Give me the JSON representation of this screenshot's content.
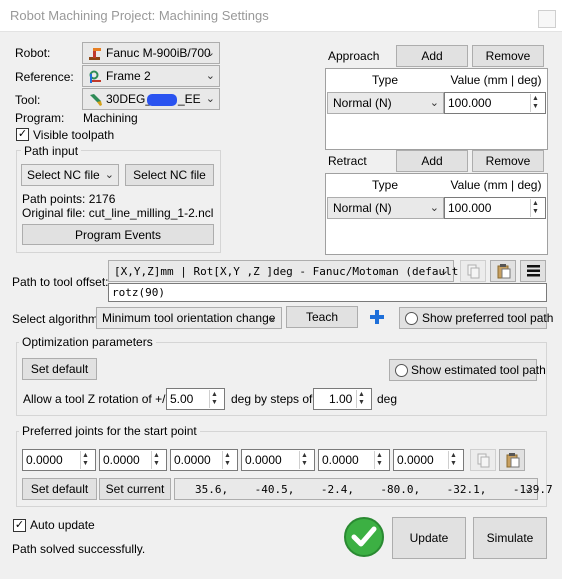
{
  "window": {
    "title": "Robot Machining Project: Machining Settings"
  },
  "robot": {
    "label": "Robot:",
    "value": "Fanuc M-900iB/700"
  },
  "reference": {
    "label": "Reference:",
    "value": "Frame 2"
  },
  "tool": {
    "label": "Tool:",
    "value_a": "30DEG_",
    "value_b": "_EE"
  },
  "program": {
    "label": "Program:",
    "value": "Machining"
  },
  "visible_toolpath": {
    "label": "Visible toolpath",
    "checked": true
  },
  "path_input": {
    "group_label": "Path input",
    "select_combo": "Select NC file",
    "select_button": "Select NC file",
    "path_points": "Path points: 2176",
    "original_file": "Original file: cut_line_milling_1-2.ncl",
    "events_button": "Program Events"
  },
  "approach": {
    "label": "Approach",
    "add": "Add",
    "remove": "Remove",
    "col_type": "Type",
    "col_value": "Value (mm | deg)",
    "row_type": "Normal (N)",
    "row_value": "100.000"
  },
  "retract": {
    "label": "Retract",
    "add": "Add",
    "remove": "Remove",
    "col_type": "Type",
    "col_value": "Value (mm | deg)",
    "row_type": "Normal (N)",
    "row_value": "100.000"
  },
  "tool_offset": {
    "label": "Path to tool offset:",
    "format": "[X,Y,Z]mm | Rot[X,Y ,Z  ]deg - Fanuc/Motoman (default)",
    "expression": "rotz(90)"
  },
  "algorithm": {
    "label": "Select algorithm:",
    "value": "Minimum tool orientation change",
    "teach": "Teach",
    "show_preferred": "Show preferred tool path"
  },
  "optimization": {
    "group_label": "Optimization parameters",
    "set_default": "Set default",
    "show_estimated": "Show estimated tool path",
    "allow_label": "Allow a tool Z rotation of +/-",
    "rotation_value": "5.00",
    "steps_label": "deg by steps of",
    "step_value": "1.00",
    "unit": "deg"
  },
  "preferred_joints": {
    "group_label": "Preferred joints for the start point",
    "inputs": [
      "0.0000",
      "0.0000",
      "0.0000",
      "0.0000",
      "0.0000",
      "0.0000"
    ],
    "set_default": "Set default",
    "set_current": "Set current",
    "current_values": "35.6,    -40.5,    -2.4,    -80.0,    -32.1,    -139.7"
  },
  "auto_update": {
    "label": "Auto update",
    "checked": true
  },
  "status": {
    "text": "Path solved successfully."
  },
  "actions": {
    "update": "Update",
    "simulate": "Simulate"
  },
  "colors": {
    "success": "#3cb043",
    "accent_blue": "#1e6fd9",
    "tool_icon": "#2e8b57",
    "robot_icon": "#c0392b"
  }
}
